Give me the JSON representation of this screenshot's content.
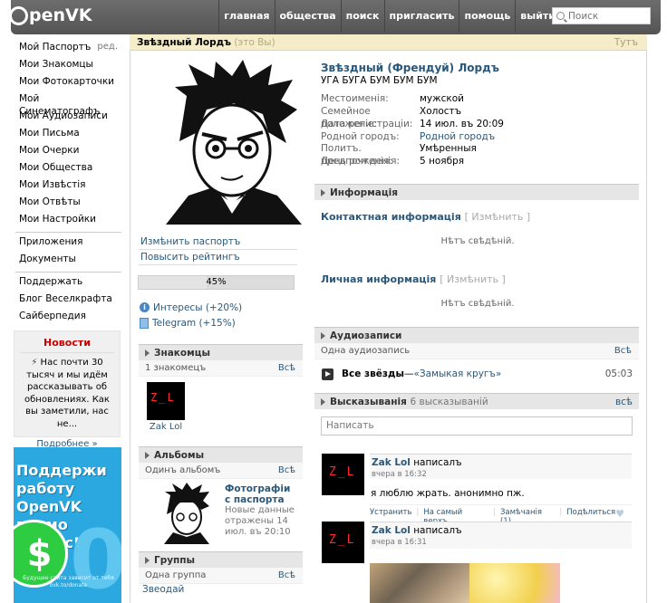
{
  "header": {
    "logo_text": "penVK",
    "nav": [
      "главная",
      "общества",
      "поиск",
      "пригласить",
      "помощь",
      "выйти"
    ],
    "search_placeholder": "Поиск"
  },
  "sidebar": {
    "items": [
      {
        "label": "Мой Паспортъ",
        "extra": "ред."
      },
      {
        "label": "Мои Знакомцы"
      },
      {
        "label": "Мои Фотокарточки"
      },
      {
        "label": "Мой Синематографъ"
      },
      {
        "label": "Мои Аудиозаписи"
      },
      {
        "label": "Мои Письма"
      },
      {
        "label": "Мои Очерки"
      },
      {
        "label": "Мои Общества"
      },
      {
        "label": "Мои Извѣстія"
      },
      {
        "label": "Мои Отвѣты"
      },
      {
        "label": "Мои Настройки"
      }
    ],
    "group2": [
      "Приложения",
      "Документы"
    ],
    "group3": [
      "Поддержать",
      "Блог Веселкрафта",
      "Сайберпедия"
    ]
  },
  "news": {
    "title": "Новости",
    "body": "Нас почти 30 тысяч и мы идём рассказывать об обновлениях. Как вы заметили, нас не...",
    "more": "Подробнее »"
  },
  "ad": {
    "text": "Поддержи работу OpenVK прямо сейчас!",
    "small": "Будущее сайта зависит от тебя ovk.to/donate"
  },
  "topbar": {
    "name": "Звѣздный Лордъ",
    "you": "(это Вы)",
    "right": "Тутъ"
  },
  "left_col": {
    "edit_passport": "Измѣнить паспортъ",
    "boost_rating": "Повысить рейтингъ",
    "progress_label": "45%",
    "progress_value": 45,
    "bonuses": [
      "Интересы (+20%)",
      "Telegram (+15%)"
    ],
    "friends": {
      "title": "Знакомцы",
      "count": "1 знакомецъ",
      "all": "Всѣ",
      "friend_name": "Zak Lol"
    },
    "albums": {
      "title": "Альбомы",
      "count": "Одинъ альбомъ",
      "all": "Всѣ",
      "album_title": "Фотографіи с паспорта",
      "album_meta": "Новые данные отражены 14 июл. въ 20:10"
    },
    "groups": {
      "title": "Группы",
      "count": "Одна группа",
      "all": "Всѣ",
      "group_name": "Звеодай"
    }
  },
  "profile": {
    "full_name": "Звѣздный (Френдуй) Лордъ",
    "status": "УГА БУГА БУМ БУМ БУМ",
    "fields": [
      {
        "k": "Местоименія:",
        "v": "мужской"
      },
      {
        "k": "Семейное положеніе:",
        "v": "Холостъ"
      },
      {
        "k": "Дата регистраціи:",
        "v": "14 июл. въ 20:09"
      },
      {
        "k": "Родной городъ:",
        "v": "Родной городъ",
        "link": true
      },
      {
        "k": "Политъ. предпочтенія:",
        "v": "Умѣренныя"
      },
      {
        "k": "День рожденія:",
        "v": "5 ноября"
      }
    ]
  },
  "info_section": {
    "title": "Информація",
    "contact_title": "Контактная информація",
    "edit": "[ Измѣнить ]",
    "no_data": "Нѣтъ свѣдѣній.",
    "personal_title": "Личная информація"
  },
  "audio": {
    "title": "Аудиозаписи",
    "count": "Одна аудиозапись",
    "all": "Всѣ",
    "track_artist": "Все звёзды",
    "track_sep": " — ",
    "track_title": "«Замыкая кругъ»",
    "duration": "05:03"
  },
  "wall": {
    "title": "Высказыванія",
    "count": "6 высказываній",
    "all": "всѣ",
    "input_placeholder": "Написать",
    "posts": [
      {
        "author": "Zak Lol",
        "action": "написалъ",
        "time": "вчера в 16:32",
        "text": "я люблю жрать. анонимно пж.",
        "actions": [
          "Устранить",
          "На самый верхъ",
          "Замѣчанія (1)",
          "Подѣлиться"
        ]
      },
      {
        "author": "Zak Lol",
        "action": "написалъ",
        "time": "вчера в 16:31"
      }
    ]
  },
  "colors": {
    "link": "#2b587a",
    "header": "#5a5a5a",
    "topbar": "#f5ecc9",
    "news_title": "#cc0000"
  }
}
